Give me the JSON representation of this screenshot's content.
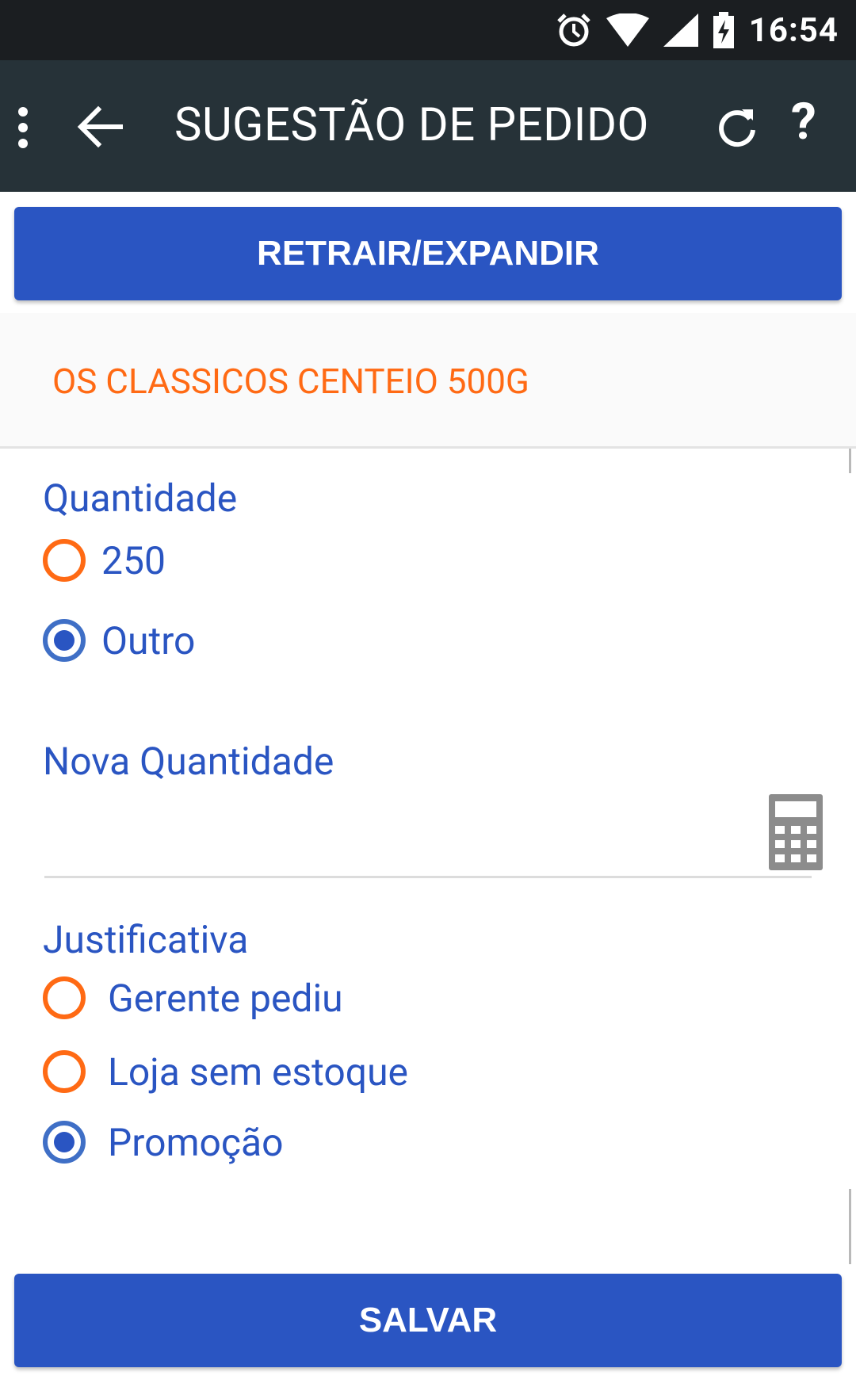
{
  "statusbar": {
    "time": "16:54",
    "icons": [
      "alarm-icon",
      "wifi-icon",
      "signal-icon",
      "battery-charging-icon"
    ]
  },
  "appbar": {
    "title": "SUGESTÃO DE PEDIDO",
    "icons": [
      "overflow-menu-icon",
      "back-arrow-icon",
      "refresh-icon",
      "help-icon"
    ],
    "help_symbol": "?"
  },
  "toggle_button": {
    "label": "RETRAIR/EXPANDIR"
  },
  "product": {
    "name": "OS CLASSICOS CENTEIO 500G"
  },
  "quantity": {
    "title": "Quantidade",
    "options": [
      {
        "label": "250",
        "selected": false
      },
      {
        "label": "Outro",
        "selected": true
      }
    ]
  },
  "new_quantity": {
    "title": "Nova Quantidade",
    "value": ""
  },
  "justification": {
    "title": "Justificativa",
    "options": [
      {
        "label": "Gerente pediu",
        "selected": false
      },
      {
        "label": "Loja sem estoque",
        "selected": false
      },
      {
        "label": "Promoção",
        "selected": true
      }
    ]
  },
  "save_button": {
    "label": "SALVAR"
  },
  "colors": {
    "statusbar": "#1b1e21",
    "appbar": "#263238",
    "primary": "#2a55c2",
    "accent": "#ff6a14",
    "radio_selected_ring": "#3f6fc6"
  }
}
